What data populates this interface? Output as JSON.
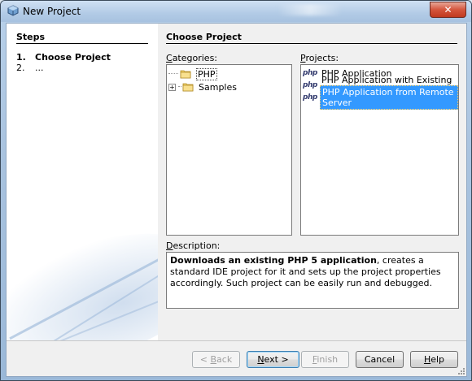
{
  "window": {
    "title": "New Project",
    "close_symbol": "✕"
  },
  "steps": {
    "heading": "Steps",
    "items": [
      {
        "num": "1.",
        "label": "Choose Project"
      },
      {
        "num": "2.",
        "label": "..."
      }
    ]
  },
  "main": {
    "heading": "Choose Project",
    "categories_label": "Categories:",
    "projects_label": "Projects:",
    "description_label": "Description:"
  },
  "categories": [
    {
      "label": "PHP",
      "expander": "",
      "selected": true,
      "icon": "folder-icon"
    },
    {
      "label": "Samples",
      "expander": "+",
      "selected": false,
      "icon": "folder-icon"
    }
  ],
  "projects": [
    {
      "label": "PHP Application",
      "icon_text": "php",
      "selected": false
    },
    {
      "label": "PHP Application with Existing Sources",
      "icon_text": "php",
      "selected": false
    },
    {
      "label": "PHP Application from Remote Server",
      "icon_text": "php",
      "selected": true
    }
  ],
  "description": {
    "bold": "Downloads an existing PHP 5 application",
    "rest": ", creates a standard IDE project for it and sets up the project properties accordingly. Such project can be easily run and debugged."
  },
  "buttons": {
    "back": "< Back",
    "next": "Next >",
    "finish": "Finish",
    "cancel": "Cancel",
    "help": "Help"
  },
  "colors": {
    "selection": "#3399ff",
    "close_button": "#c0391f"
  }
}
